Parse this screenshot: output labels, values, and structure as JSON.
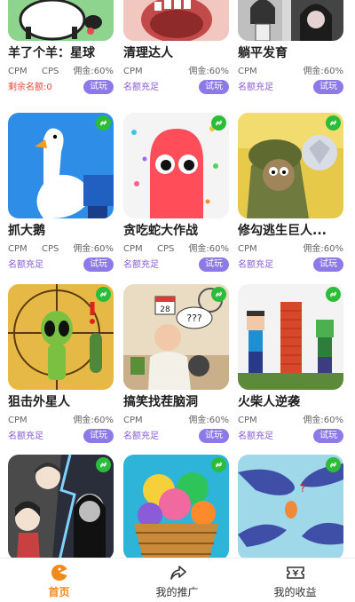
{
  "games": [
    {
      "title": "羊了个羊：星球",
      "cpm": "CPM",
      "cps": "CPS",
      "commission": "佣金:60%",
      "status": "剩余名额:0",
      "status_red": true,
      "try_label": "试玩",
      "thumb_icon": "sheep-thumb-icon",
      "has_link": false
    },
    {
      "title": "清理达人",
      "cpm": "CPM",
      "cps": "",
      "commission": "佣金:60%",
      "status": "名额充足",
      "status_red": false,
      "try_label": "试玩",
      "thumb_icon": "mouth-thumb-icon",
      "has_link": false
    },
    {
      "title": "躺平发育",
      "cpm": "CPM",
      "cps": "",
      "commission": "佣金:60%",
      "status": "名额充足",
      "status_red": false,
      "try_label": "试玩",
      "thumb_icon": "girl-thumb-icon",
      "has_link": false
    },
    {
      "title": "抓大鹅",
      "cpm": "CPM",
      "cps": "CPS",
      "commission": "佣金:60%",
      "status": "名额充足",
      "status_red": false,
      "try_label": "试玩",
      "thumb_icon": "goose-thumb-icon",
      "has_link": true
    },
    {
      "title": "贪吃蛇大作战",
      "cpm": "CPM",
      "cps": "CPS",
      "commission": "佣金:60%",
      "status": "名额充足",
      "status_red": false,
      "try_label": "试玩",
      "thumb_icon": "snake-thumb-icon",
      "has_link": true
    },
    {
      "title": "修勾逃生巨人...",
      "cpm": "CPM",
      "cps": "",
      "commission": "佣金:60%",
      "status": "名额充足",
      "status_red": false,
      "try_label": "试玩",
      "thumb_icon": "dog-soldier-thumb-icon",
      "has_link": true
    },
    {
      "title": "狙击外星人",
      "cpm": "CPM",
      "cps": "",
      "commission": "佣金:60%",
      "status": "名额充足",
      "status_red": false,
      "try_label": "试玩",
      "thumb_icon": "alien-thumb-icon",
      "has_link": true
    },
    {
      "title": "搞笑找茬脑洞",
      "cpm": "CPM",
      "cps": "",
      "commission": "佣金:60%",
      "status": "名额充足",
      "status_red": false,
      "try_label": "试玩",
      "thumb_icon": "man-cooking-thumb-icon",
      "has_link": true,
      "thumb_text_calendar": "28",
      "thumb_text_bubble": "???"
    },
    {
      "title": "火柴人逆袭",
      "cpm": "CPM",
      "cps": "",
      "commission": "佣金:60%",
      "status": "名额充足",
      "status_red": false,
      "try_label": "试玩",
      "thumb_icon": "pixel-stickman-thumb-icon",
      "has_link": true
    },
    {
      "title": "",
      "cpm": "",
      "cps": "",
      "commission": "",
      "status": "",
      "status_red": false,
      "try_label": "",
      "thumb_icon": "horror-family-thumb-icon",
      "has_link": true
    },
    {
      "title": "",
      "cpm": "",
      "cps": "",
      "commission": "",
      "status": "",
      "status_red": false,
      "try_label": "",
      "thumb_icon": "basket-ribbons-thumb-icon",
      "has_link": true
    },
    {
      "title": "",
      "cpm": "",
      "cps": "",
      "commission": "",
      "status": "",
      "status_red": false,
      "try_label": "",
      "thumb_icon": "fish-water-thumb-icon",
      "has_link": true,
      "thumb_text_question": "?"
    }
  ],
  "tabbar": {
    "tabs": [
      {
        "label": "首页",
        "icon": "home-pacman-icon",
        "active": true
      },
      {
        "label": "我的推广",
        "icon": "share-arrow-icon",
        "active": false
      },
      {
        "label": "我的收益",
        "icon": "income-ticket-icon",
        "active": false
      }
    ]
  },
  "colors": {
    "accent": "#8e79e9",
    "status_purple": "#8a5cd8",
    "status_red": "#e84a3a",
    "active_tab": "#f08a1c",
    "link_badge": "#2bbd3a"
  }
}
